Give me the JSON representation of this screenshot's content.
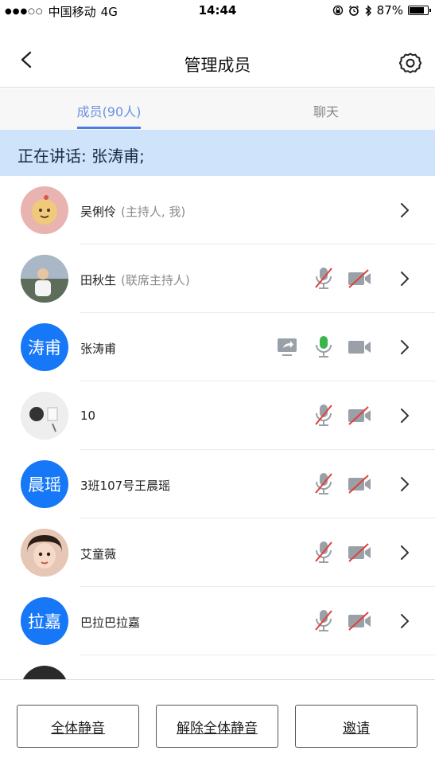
{
  "status_bar": {
    "carrier": "中国移动",
    "network": "4G",
    "time": "14:44",
    "battery_percent_label": "87%",
    "battery_level": 0.87
  },
  "nav": {
    "title": "管理成员",
    "back_icon": "chevron-left-icon",
    "settings_icon": "gear-icon"
  },
  "tabs": [
    {
      "label": "成员(90人)",
      "active": true
    },
    {
      "label": "聊天",
      "active": false
    }
  ],
  "banner": {
    "text": "正在讲话: 张涛甫;"
  },
  "members": [
    {
      "name": "吴俐伶",
      "role": "(主持人, 我)",
      "avatar_type": "image",
      "avatar_text": "",
      "avatar_color": "#e9b3b0",
      "mic": "",
      "camera": "",
      "screen_share": false
    },
    {
      "name": "田秋生",
      "role": "(联席主持人)",
      "avatar_type": "image",
      "avatar_text": "",
      "avatar_color": "#7c8a99",
      "mic": "muted",
      "camera": "off",
      "screen_share": false
    },
    {
      "name": "张涛甫",
      "role": "",
      "avatar_type": "text",
      "avatar_text": "涛甫",
      "avatar_color": "#1677f7",
      "mic": "active",
      "camera": "on",
      "screen_share": true
    },
    {
      "name": "10",
      "role": "",
      "avatar_type": "image",
      "avatar_text": "",
      "avatar_color": "#d9d9d9",
      "mic": "muted",
      "camera": "off",
      "screen_share": false
    },
    {
      "name": "3班107号王晨瑶",
      "role": "",
      "avatar_type": "text",
      "avatar_text": "晨瑶",
      "avatar_color": "#1677f7",
      "mic": "muted",
      "camera": "off",
      "screen_share": false
    },
    {
      "name": "艾童薇",
      "role": "",
      "avatar_type": "image",
      "avatar_text": "",
      "avatar_color": "#c98a78",
      "mic": "muted",
      "camera": "off",
      "screen_share": false
    },
    {
      "name": "巴拉巴拉嘉",
      "role": "",
      "avatar_type": "text",
      "avatar_text": "拉嘉",
      "avatar_color": "#1677f7",
      "mic": "muted",
      "camera": "off",
      "screen_share": false
    }
  ],
  "bottom_buttons": {
    "mute_all": "全体静音",
    "unmute_all": "解除全体静音",
    "invite": "邀请"
  },
  "colors": {
    "accent": "#4a7bea",
    "banner_bg": "#cfe3fb",
    "avatar_blue": "#1677f7",
    "mic_active": "#39b54a",
    "muted_red": "#e0403a",
    "icon_gray": "#9aa0a8"
  }
}
